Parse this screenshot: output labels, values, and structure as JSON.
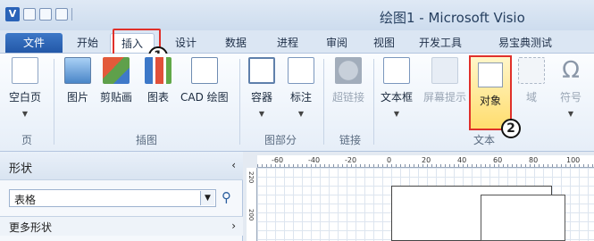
{
  "app": {
    "title": "绘图1 - Microsoft Visio",
    "logo": "V"
  },
  "tabs": [
    "文件",
    "开始",
    "插入",
    "设计",
    "数据",
    "进程",
    "审阅",
    "视图",
    "开发工具",
    "易宝典测试"
  ],
  "markers": {
    "one": "1",
    "two": "2"
  },
  "ribbon": {
    "buttons": {
      "blank_page": "空白页",
      "picture": "图片",
      "clipart": "剪贴画",
      "chart": "图表",
      "cad": "CAD 绘图",
      "container": "容器",
      "callout": "标注",
      "hyperlink": "超链接",
      "textbox": "文本框",
      "screentip": "屏幕提示",
      "object": "对象",
      "field": "域",
      "symbol": "符号"
    },
    "groups": {
      "pages": "页",
      "illustrations": "插图",
      "diagram_parts": "图部分",
      "links": "链接",
      "text": "文本"
    },
    "symbol_glyph": "Ω"
  },
  "shapes_pane": {
    "title": "形状",
    "collapse": "‹",
    "search_value": "表格",
    "more": "更多形状",
    "more_arrow": "›"
  },
  "ruler": {
    "h_ticks": [
      "-60",
      "-40",
      "-20",
      "0",
      "20",
      "40",
      "60",
      "80",
      "100"
    ],
    "v_ticks": [
      "220",
      "200"
    ]
  }
}
